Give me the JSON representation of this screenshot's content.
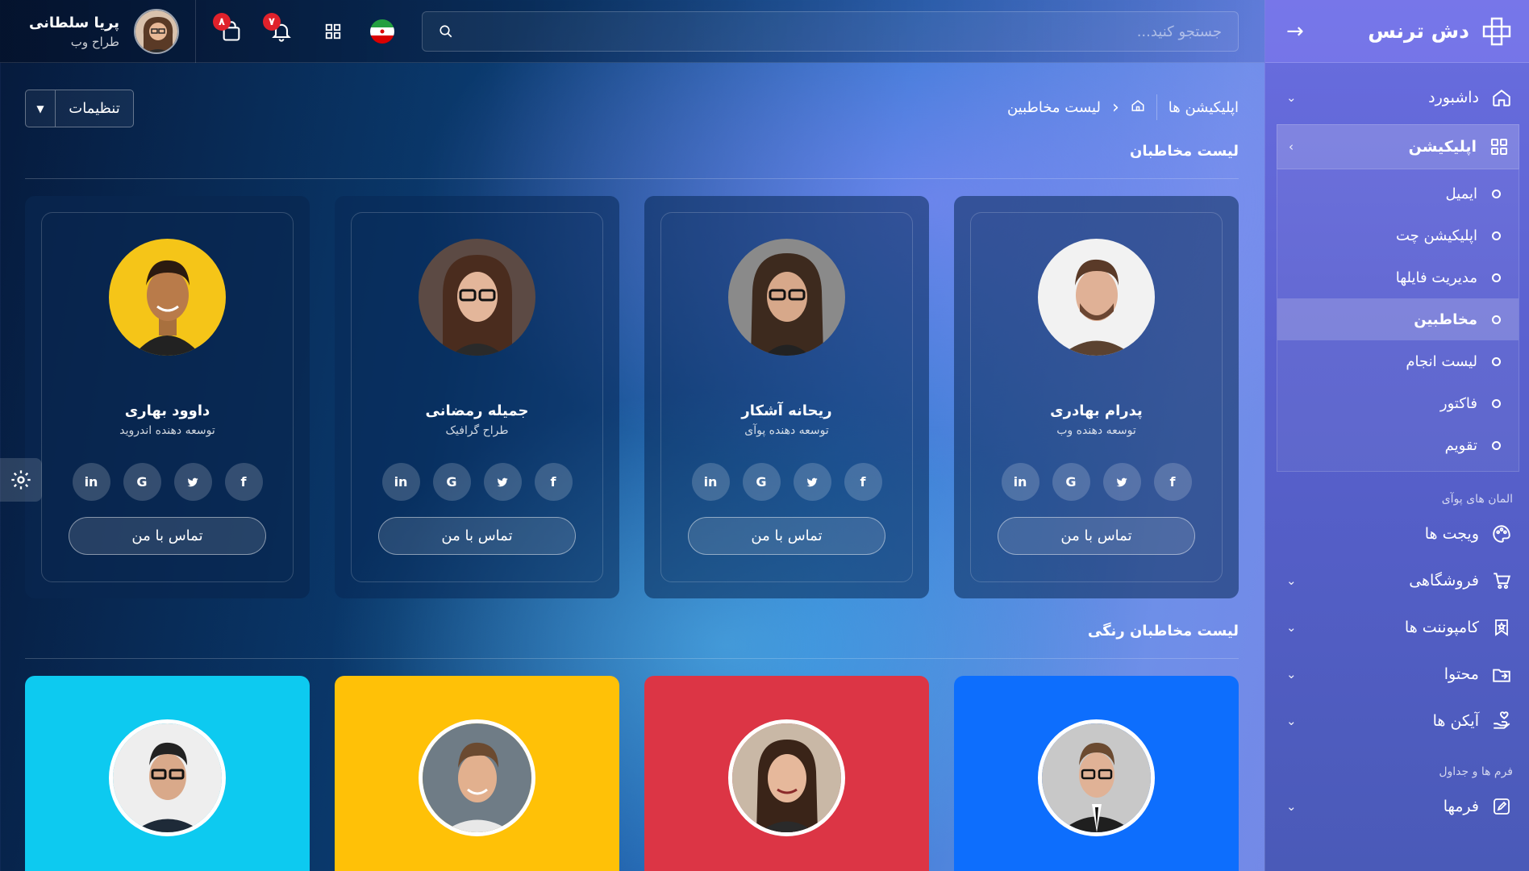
{
  "brand": {
    "name": "دش ترنس"
  },
  "topbar": {
    "search_placeholder": "جستجو کنید...",
    "cart_badge": "۸",
    "bell_badge": "۷"
  },
  "user": {
    "name": "پریا سلطانی",
    "role": "طراح وب"
  },
  "sidebar": {
    "dashboard": "داشبورد",
    "apps": "اپلیکیشن",
    "sub_items": [
      "ایمیل",
      "اپلیکیشن چت",
      "مدیریت فایلها",
      "مخاطبین",
      "لیست انجام",
      "فاکتور",
      "تقویم"
    ],
    "section_elements": "المان های پوآی",
    "widgets": "ویجت ها",
    "shop": "فروشگاهی",
    "components": "کامپوننت ها",
    "content": "محتوا",
    "icons": "آیکن ها",
    "section_forms": "فرم ها و جداول",
    "forms": "فرمها"
  },
  "page": {
    "settings_label": "تنظیمات",
    "breadcrumb_root": "اپلیکیشن ها",
    "breadcrumb_current": "لیست مخاطبین",
    "section1_title": "لیست مخاطبان",
    "section2_title": "لیست مخاطبان رنگی",
    "contact_label": "تماس با من"
  },
  "contacts": [
    {
      "name": "پدرام بهادری",
      "role": "توسعه دهنده وب"
    },
    {
      "name": "ریحانه آشکار",
      "role": "توسعه دهنده پوآی"
    },
    {
      "name": "جمیله رمضانی",
      "role": "طراح گرافیک"
    },
    {
      "name": "داوود بهاری",
      "role": "توسعه دهنده اندروید"
    }
  ],
  "socials": [
    "f",
    "t",
    "G",
    "in"
  ],
  "colors": {
    "card_blue": "#0d6efd",
    "card_red": "#dc3545",
    "card_yellow": "#ffc107",
    "card_cyan": "#0dcaf0",
    "badge": "#e0212b"
  }
}
